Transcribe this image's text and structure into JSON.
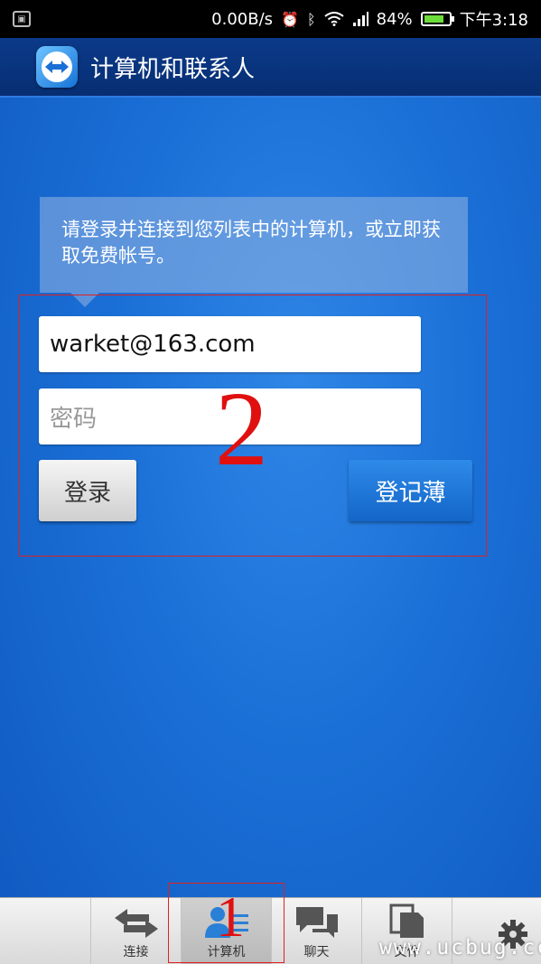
{
  "status_bar": {
    "net_speed": "0.00B/s",
    "battery": "84%",
    "time": "下午3:18",
    "icons": [
      "notification-icon",
      "alarm-icon",
      "bluetooth-icon",
      "wifi-icon",
      "signal-icon",
      "battery-icon"
    ]
  },
  "app_bar": {
    "title": "计算机和联系人"
  },
  "info": {
    "text": "请登录并连接到您列表中的计算机，或立即获取免费帐号。"
  },
  "form": {
    "email_value": "warket@163.com",
    "password_placeholder": "密码",
    "login_label": "登录",
    "register_label": "登记薄"
  },
  "annotations": {
    "mark_1": "1",
    "mark_2": "2",
    "color": "#e02020"
  },
  "tabs": [
    {
      "label": "连接",
      "icon": "arrows-icon"
    },
    {
      "label": "计算机",
      "icon": "contacts-icon",
      "active": true
    },
    {
      "label": "聊天",
      "icon": "chat-icon"
    },
    {
      "label": "文件",
      "icon": "files-icon"
    }
  ],
  "watermark": "www.ucbug.cc"
}
